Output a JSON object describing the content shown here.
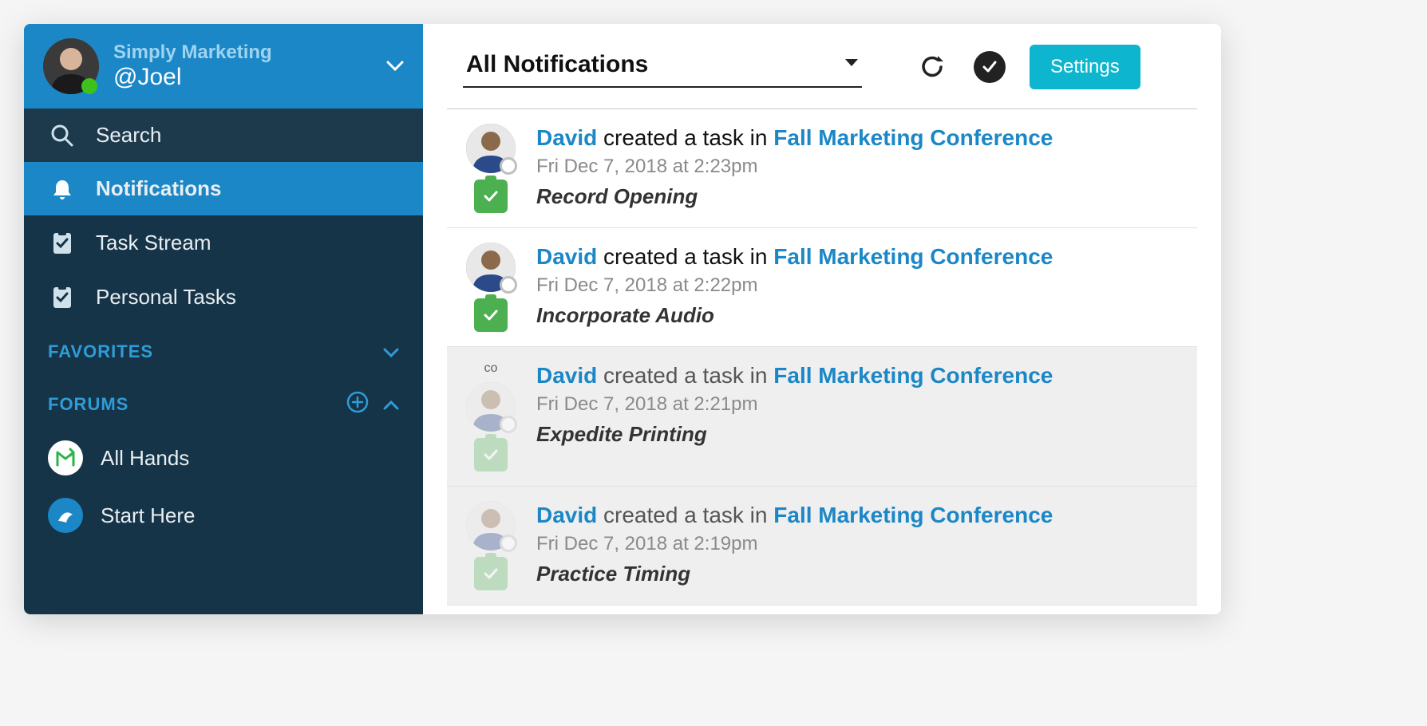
{
  "profile": {
    "org": "Simply Marketing",
    "handle": "@Joel"
  },
  "nav": {
    "search": "Search",
    "notifications": "Notifications",
    "task_stream": "Task Stream",
    "personal_tasks": "Personal Tasks"
  },
  "sections": {
    "favorites": "FAVORITES",
    "forums": "FORUMS"
  },
  "forums": [
    {
      "label": "All Hands"
    },
    {
      "label": "Start Here"
    }
  ],
  "toolbar": {
    "filter": "All Notifications",
    "settings": "Settings"
  },
  "notifications": [
    {
      "actor": "David",
      "verb": " created a task in ",
      "target": "Fall Marketing Conference",
      "time": "Fri Dec 7, 2018 at 2:23pm",
      "task": "Record Opening",
      "read": false
    },
    {
      "actor": "David",
      "verb": " created a task in ",
      "target": "Fall Marketing Conference",
      "time": "Fri Dec 7, 2018 at 2:22pm",
      "task": "Incorporate Audio",
      "read": false
    },
    {
      "actor": "David",
      "verb": " created a task in ",
      "target": "Fall Marketing Conference",
      "time": "Fri Dec 7, 2018 at 2:21pm",
      "task": "Expedite Printing",
      "read": true
    },
    {
      "actor": "David",
      "verb": " created a task in ",
      "target": "Fall Marketing Conference",
      "time": "Fri Dec 7, 2018 at 2:19pm",
      "task": "Practice Timing",
      "read": true
    }
  ]
}
